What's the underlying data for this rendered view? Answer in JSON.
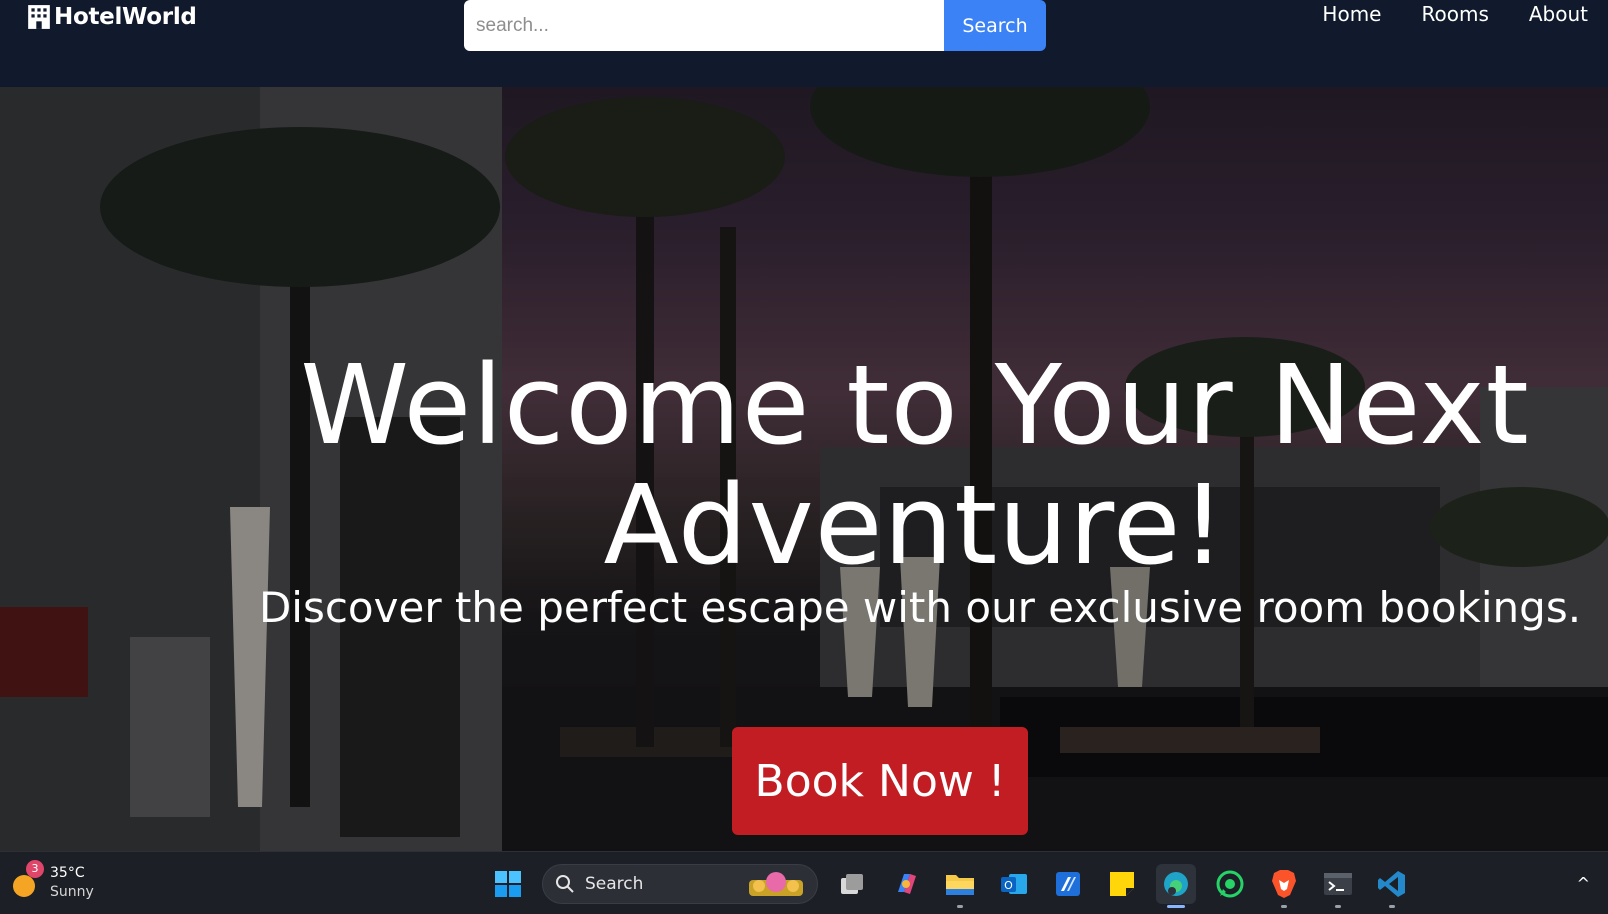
{
  "navbar": {
    "brand_name": "HotelWorld",
    "brand_icon": "hotel-building-icon",
    "search": {
      "placeholder": "search...",
      "value": "",
      "button_label": "Search"
    },
    "links": [
      "Home",
      "Rooms",
      "About"
    ]
  },
  "hero": {
    "title": "Welcome to Your Next Adventure!",
    "subtitle": "Discover the perfect escape with our exclusive room bookings.",
    "cta_label": "Book Now !"
  },
  "taskbar": {
    "weather": {
      "badge": "3",
      "temperature": "35°C",
      "condition": "Sunny"
    },
    "search_label": "Search",
    "apps": [
      "start-icon",
      "task-view-icon",
      "copilot-icon",
      "file-explorer-icon",
      "outlook-icon",
      "azure-icon",
      "sticky-notes-icon",
      "edge-icon",
      "whatsapp-icon",
      "brave-icon",
      "terminal-icon",
      "vscode-icon"
    ],
    "tray_chevron": "^"
  },
  "colors": {
    "navbar_bg": "#111a2c",
    "search_button": "#3b82f6",
    "book_button": "#c31d24",
    "taskbar_bg": "#1c1f26"
  }
}
